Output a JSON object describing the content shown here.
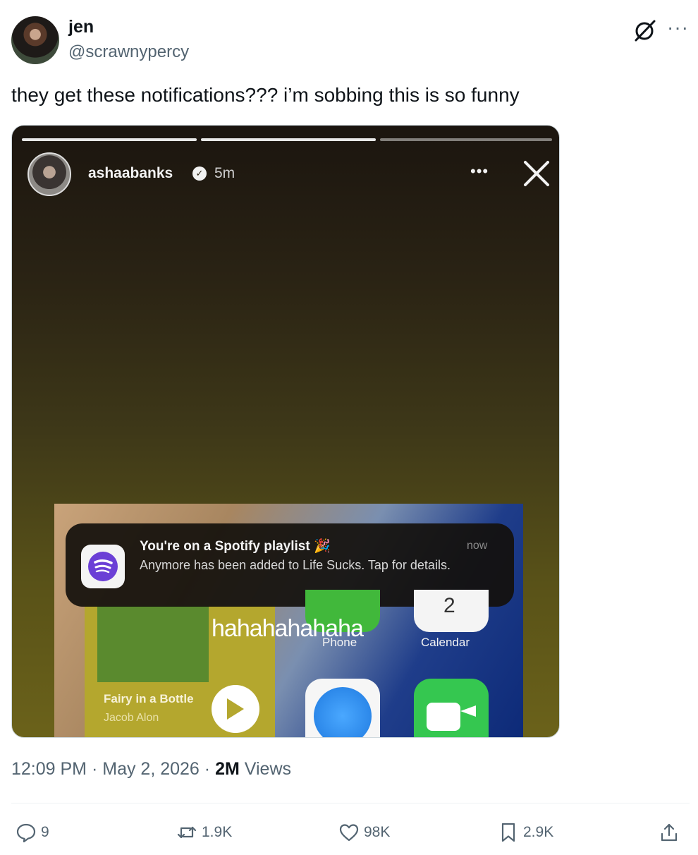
{
  "tweet": {
    "author_name": "jen",
    "author_handle": "@scrawnypercy",
    "text": "they get these notifications??? i’m sobbing this is so funny",
    "time": "12:09 PM",
    "date": "May 2, 2026",
    "views_count": "2M",
    "views_label": "Views",
    "separator": "·"
  },
  "story": {
    "username": "ashaabanks",
    "age": "5m",
    "notification": {
      "title": "You're on a Spotify playlist 🎉",
      "body": "Anymore has been added to Life Sucks. Tap for details.",
      "time": "now"
    },
    "caption": "hahahahahaha",
    "widget": {
      "song": "Fairy in a Bottle",
      "artist": "Jacob Alon"
    },
    "apps": {
      "phone": "Phone",
      "calendar": "Calendar",
      "calendar_day": "2"
    }
  },
  "actions": {
    "replies": "9",
    "reposts": "1.9K",
    "likes": "98K",
    "bookmarks": "2.9K"
  },
  "icons": [
    "grok-icon",
    "more-icon",
    "reply-icon",
    "repost-icon",
    "like-icon",
    "bookmark-icon",
    "share-icon",
    "spotify-icon",
    "close-icon",
    "verified-icon"
  ],
  "colors": {
    "text_primary": "#0f1419",
    "text_secondary": "#536471",
    "divider": "#eff3f4"
  }
}
